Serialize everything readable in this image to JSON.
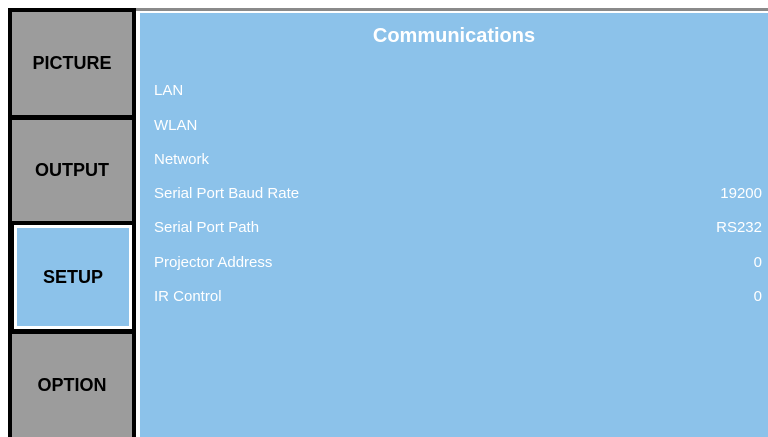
{
  "sidebar": {
    "tabs": [
      {
        "label": "PICTURE",
        "active": false
      },
      {
        "label": "OUTPUT",
        "active": false
      },
      {
        "label": "SETUP",
        "active": true
      },
      {
        "label": "OPTION",
        "active": false
      }
    ]
  },
  "panel": {
    "title": "Communications",
    "items": [
      {
        "label": "LAN",
        "value": ""
      },
      {
        "label": "WLAN",
        "value": ""
      },
      {
        "label": "Network",
        "value": ""
      },
      {
        "label": "Serial Port Baud Rate",
        "value": "19200"
      },
      {
        "label": "Serial Port Path",
        "value": "RS232"
      },
      {
        "label": "Projector Address",
        "value": "0"
      },
      {
        "label": "IR Control",
        "value": "0"
      }
    ]
  },
  "colors": {
    "panel_bg": "#8cc2ea",
    "tab_bg": "#9c9c9c",
    "sidebar_bg": "#000000",
    "text": "#ffffff"
  }
}
